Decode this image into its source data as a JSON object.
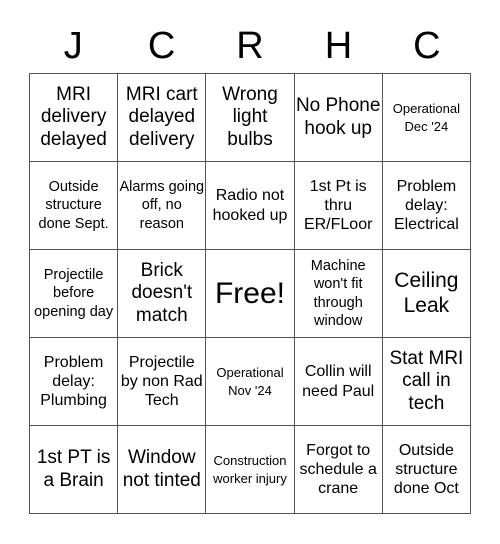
{
  "header": {
    "letters": [
      "J",
      "C",
      "R",
      "H",
      "C"
    ]
  },
  "board": {
    "rows": [
      [
        {
          "text": "MRI delivery delayed"
        },
        {
          "text": "MRI cart delayed delivery"
        },
        {
          "text": "Wrong light bulbs"
        },
        {
          "text": "No Phone hook up"
        },
        {
          "text": "Operational Dec '24"
        }
      ],
      [
        {
          "text": "Outside structure done Sept."
        },
        {
          "text": "Alarms going off, no reason"
        },
        {
          "text": "Radio not hooked up"
        },
        {
          "text": "1st Pt is thru ER/FLoor"
        },
        {
          "text": "Problem delay: Electrical"
        }
      ],
      [
        {
          "text": "Projectile before opening day"
        },
        {
          "text": "Brick doesn't match"
        },
        {
          "text": "Free!",
          "free": true
        },
        {
          "text": "Machine won't fit through window"
        },
        {
          "text": "Ceiling Leak"
        }
      ],
      [
        {
          "text": "Problem delay: Plumbing"
        },
        {
          "text": "Projectile by non Rad Tech"
        },
        {
          "text": "Operational Nov '24"
        },
        {
          "text": "Collin will need Paul"
        },
        {
          "text": "Stat MRI call in tech"
        }
      ],
      [
        {
          "text": "1st PT is a Brain"
        },
        {
          "text": "Window not tinted"
        },
        {
          "text": "Construction worker injury"
        },
        {
          "text": "Forgot to schedule a crane"
        },
        {
          "text": "Outside structure done Oct"
        }
      ]
    ]
  },
  "colors": {
    "border": "#555555",
    "text": "#000000",
    "background": "#ffffff"
  }
}
